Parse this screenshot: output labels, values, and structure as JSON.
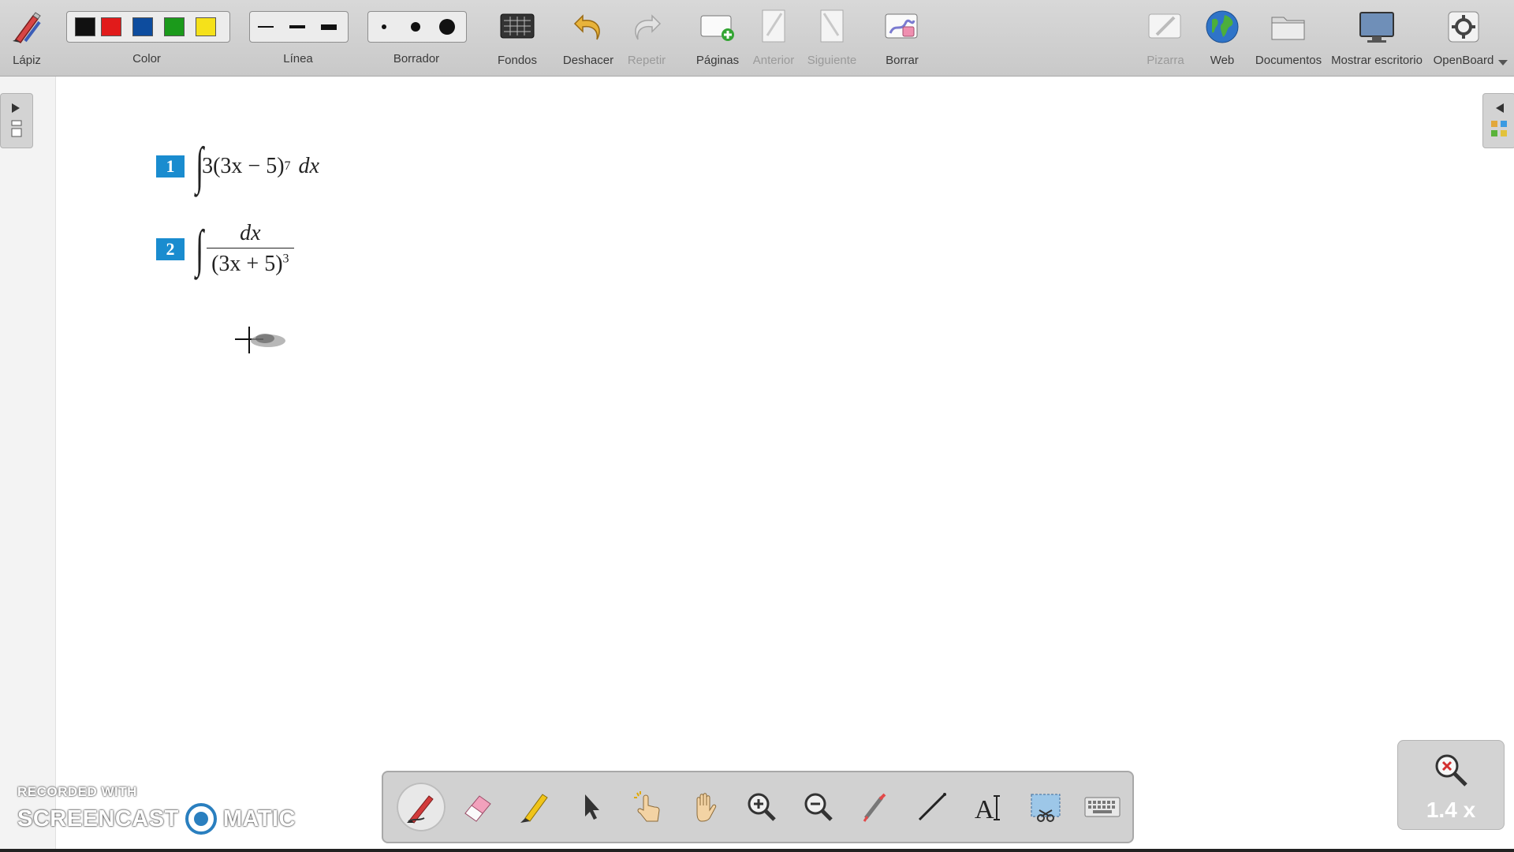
{
  "toolbar": {
    "pen_label": "Lápiz",
    "color_label": "Color",
    "line_label": "Línea",
    "eraser_label": "Borrador",
    "backgrounds_label": "Fondos",
    "undo_label": "Deshacer",
    "redo_label": "Repetir",
    "pages_label": "Páginas",
    "previous_label": "Anterior",
    "next_label": "Siguiente",
    "clear_label": "Borrar",
    "board_label": "Pizarra",
    "web_label": "Web",
    "documents_label": "Documentos",
    "show_desktop_label": "Mostrar escritorio",
    "app_label": "OpenBoard",
    "colors": [
      "#111111",
      "#e11b1b",
      "#0d4c9e",
      "#1b9a1b",
      "#f5e11a"
    ]
  },
  "board": {
    "problems": [
      {
        "number": "1",
        "integrand": "3(3x − 5)",
        "exponent": "7",
        "differential": "dx"
      },
      {
        "number": "2",
        "numerator": "dx",
        "denominator": "(3x + 5)",
        "exponent": "3"
      }
    ]
  },
  "bottom_tools": [
    "pen-tool",
    "eraser-tool",
    "highlighter-tool",
    "select-tool",
    "interact-tool",
    "hand-tool",
    "zoom-in-tool",
    "zoom-out-tool",
    "laser-pointer-tool",
    "line-tool",
    "text-tool",
    "capture-tool",
    "keyboard-tool"
  ],
  "zoom": {
    "level": "1.4 x"
  },
  "watermark": {
    "line1": "RECORDED WITH",
    "brand_left": "SCREENCAST",
    "brand_right": "MATIC"
  }
}
